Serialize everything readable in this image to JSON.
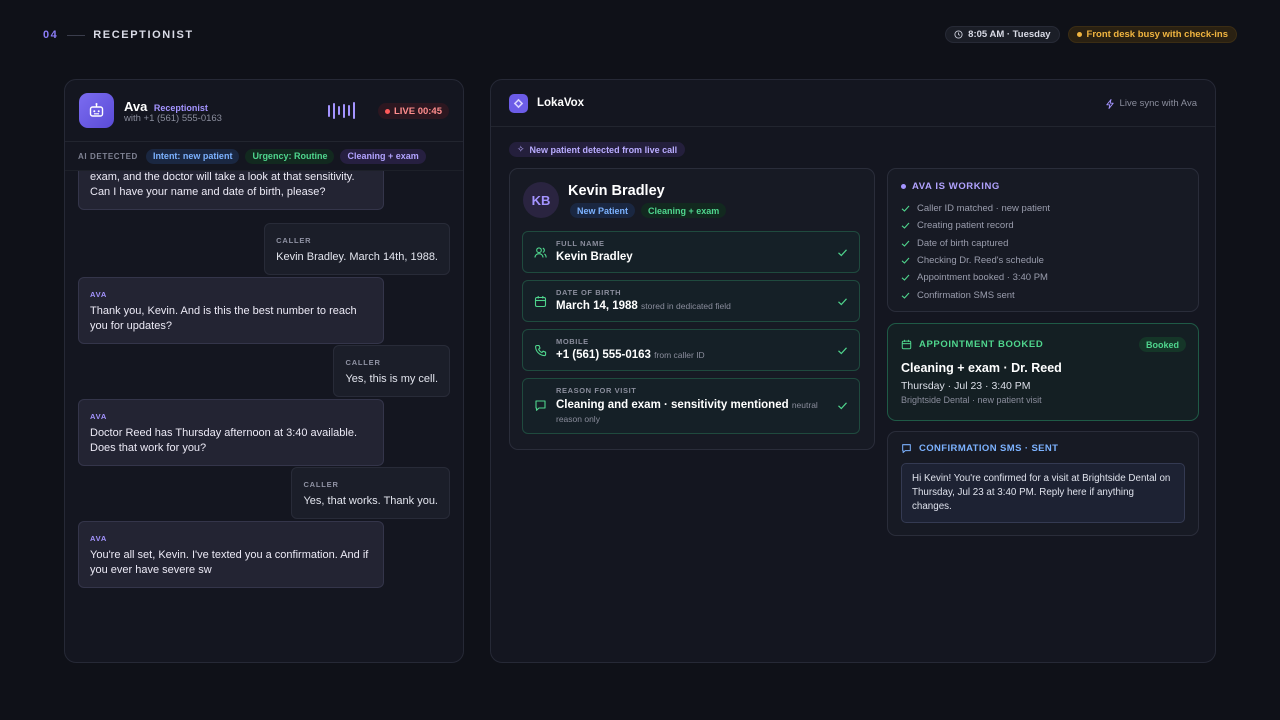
{
  "header": {
    "step_number": "04",
    "step_title": "RECEPTIONIST",
    "time_chip": "8:05 AM · Tuesday",
    "status_chip": "Front desk busy with check-ins"
  },
  "call": {
    "agent_name": "Ava",
    "agent_role": "Receptionist",
    "caller_line": "with +1 (561) 555-0163",
    "live_label": "LIVE 00:45",
    "ai_detected_label": "AI DETECTED",
    "ai_tags": [
      "Intent: new patient",
      "Urgency: Routine",
      "Cleaning + exam"
    ],
    "messages": [
      {
        "speaker": "",
        "text": "exam, and the doctor will take a look at that sensitivity. Can I have your name and date of birth, please?"
      },
      {
        "speaker": "CALLER",
        "text": "Kevin Bradley. March 14th, 1988."
      },
      {
        "speaker": "AVA",
        "text": "Thank you, Kevin. And is this the best number to reach you for updates?"
      },
      {
        "speaker": "CALLER",
        "text": "Yes, this is my cell."
      },
      {
        "speaker": "AVA",
        "text": "Doctor Reed has Thursday afternoon at 3:40 available. Does that work for you?"
      },
      {
        "speaker": "CALLER",
        "text": "Yes, that works. Thank you."
      },
      {
        "speaker": "AVA",
        "text": "You're all set, Kevin. I've texted you a confirmation. And if you ever have severe sw"
      }
    ]
  },
  "app": {
    "name": "LokaVox",
    "sync_label": "Live sync with Ava",
    "detected_banner": "New patient detected from live call"
  },
  "patient": {
    "initials": "KB",
    "name": "Kevin Bradley",
    "tags": [
      "New Patient",
      "Cleaning + exam"
    ],
    "fields": [
      {
        "label": "FULL NAME",
        "value": "Kevin Bradley",
        "note": "",
        "icon": "user-icon"
      },
      {
        "label": "DATE OF BIRTH",
        "value": "March 14, 1988",
        "note": "stored in dedicated field",
        "icon": "calendar-icon"
      },
      {
        "label": "MOBILE",
        "value": "+1 (561) 555-0163",
        "note": "from caller ID",
        "icon": "phone-icon"
      },
      {
        "label": "REASON FOR VISIT",
        "value": "Cleaning and exam · sensitivity mentioned",
        "note": "neutral reason only",
        "icon": "message-icon"
      }
    ]
  },
  "working": {
    "title": "AVA IS WORKING",
    "steps": [
      "Caller ID matched · new patient",
      "Creating patient record",
      "Date of birth captured",
      "Checking Dr. Reed's schedule",
      "Appointment booked · 3:40 PM",
      "Confirmation SMS sent"
    ]
  },
  "appointment": {
    "title": "APPOINTMENT BOOKED",
    "badge": "Booked",
    "service": "Cleaning + exam · Dr. Reed",
    "when": "Thursday · Jul 23 · 3:40 PM",
    "where": "Brightside Dental · new patient visit"
  },
  "sms": {
    "title": "CONFIRMATION SMS · SENT",
    "body": "Hi Kevin! You're confirmed for a visit at Brightside Dental on Thursday, Jul 23 at 3:40 PM. Reply here if anything changes."
  },
  "colors": {
    "accent": "#8b7cf6",
    "success": "#4fd58d",
    "info": "#7cb2ff",
    "warning": "#f1b540",
    "live": "#ff5a5a"
  }
}
